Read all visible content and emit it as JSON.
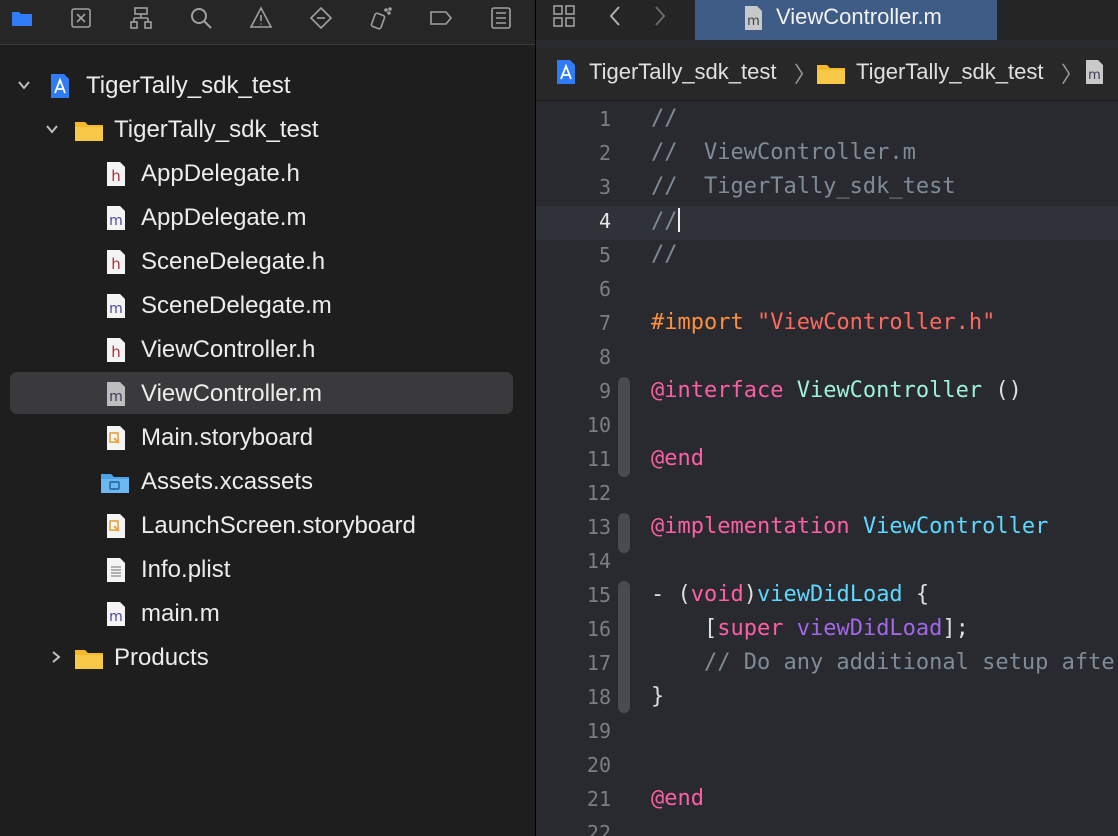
{
  "navigator": {
    "toolbar_icons": [
      "folder-icon",
      "source-control-icon",
      "hierarchy-icon",
      "search-icon",
      "warning-icon",
      "test-diamond-icon",
      "debug-spray-icon",
      "breakpoint-tag-icon",
      "report-list-icon"
    ],
    "tree": [
      {
        "label": "TigerTally_sdk_test",
        "type": "project",
        "expanded": true,
        "selected": false
      },
      {
        "label": "TigerTally_sdk_test",
        "type": "folder",
        "expanded": true,
        "selected": false
      },
      {
        "label": "AppDelegate.h",
        "type": "h",
        "selected": false
      },
      {
        "label": "AppDelegate.m",
        "type": "m",
        "selected": false
      },
      {
        "label": "SceneDelegate.h",
        "type": "h",
        "selected": false
      },
      {
        "label": "SceneDelegate.m",
        "type": "m",
        "selected": false
      },
      {
        "label": "ViewController.h",
        "type": "h",
        "selected": false
      },
      {
        "label": "ViewController.m",
        "type": "m",
        "selected": true
      },
      {
        "label": "Main.storyboard",
        "type": "storyboard",
        "selected": false
      },
      {
        "label": "Assets.xcassets",
        "type": "assets",
        "selected": false
      },
      {
        "label": "LaunchScreen.storyboard",
        "type": "storyboard",
        "selected": false
      },
      {
        "label": "Info.plist",
        "type": "plist",
        "selected": false
      },
      {
        "label": "main.m",
        "type": "m",
        "selected": false
      },
      {
        "label": "Products",
        "type": "folder",
        "expanded": false,
        "selected": false
      }
    ]
  },
  "editor": {
    "tab": {
      "label": "ViewController.m",
      "icon_letter": "m"
    },
    "breadcrumb": [
      "TigerTally_sdk_test",
      "TigerTally_sdk_test"
    ],
    "current_line": 4,
    "lines": [
      {
        "n": "1",
        "t": "//"
      },
      {
        "n": "2",
        "t": "//  ViewController.m"
      },
      {
        "n": "3",
        "t": "//  TigerTally_sdk_test"
      },
      {
        "n": "4",
        "t": "//"
      },
      {
        "n": "5",
        "t": "//"
      },
      {
        "n": "6",
        "t": ""
      },
      {
        "n": "7",
        "a": "#import",
        "b": " ",
        "c": "\"ViewController.h\""
      },
      {
        "n": "8",
        "t": ""
      },
      {
        "n": "9",
        "a": "@interface",
        "b": " ",
        "c": "ViewController",
        "d": " ()"
      },
      {
        "n": "10",
        "t": ""
      },
      {
        "n": "11",
        "a": "@end"
      },
      {
        "n": "12",
        "t": ""
      },
      {
        "n": "13",
        "a": "@implementation",
        "b": " ",
        "c": "ViewController"
      },
      {
        "n": "14",
        "t": ""
      },
      {
        "n": "15",
        "a": "- (",
        "b": "void",
        ")": ")",
        "c": "viewDidLoad",
        "d": " {"
      },
      {
        "n": "16",
        "a": "    [",
        "b": "super",
        "c": " ",
        "d": "viewDidLoad",
        "e": "];"
      },
      {
        "n": "17",
        "t": "    // Do any additional setup after loading the view."
      },
      {
        "n": "18",
        "t": "}"
      },
      {
        "n": "19",
        "t": ""
      },
      {
        "n": "20",
        "t": ""
      },
      {
        "n": "21",
        "a": "@end"
      },
      {
        "n": "22",
        "t": ""
      }
    ]
  },
  "colors": {
    "selection": "#3a3a3c",
    "tab_active": "#3e5c85",
    "editor_bg": "#292a30",
    "keyword": "#fc5fa3",
    "string": "#fc6a5d",
    "comment": "#7f8c98",
    "class": "#9ef1dd"
  }
}
